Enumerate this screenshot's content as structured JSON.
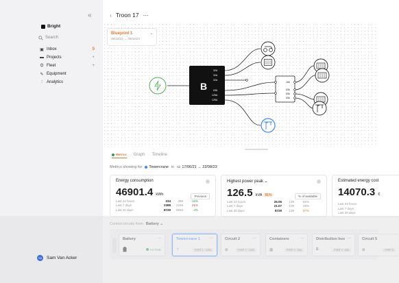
{
  "sidebar": {
    "collapse": "«",
    "brand": "Bright",
    "search_placeholder": "Search",
    "items": [
      {
        "label": "Inbox",
        "icon": "inbox-icon",
        "glyph": "▣",
        "badge": "5"
      },
      {
        "label": "Projects",
        "icon": "folder-icon",
        "glyph": "▬",
        "action": "+"
      },
      {
        "label": "Fleet",
        "icon": "fleet-icon",
        "glyph": "⛭",
        "action": "+"
      },
      {
        "label": "Equipment",
        "icon": "wrench-icon",
        "glyph": "✎"
      },
      {
        "label": "Analytics",
        "icon": "chart-icon",
        "glyph": "⫶"
      }
    ],
    "user": {
      "name": "Sam Van Acker",
      "initials": "SA"
    }
  },
  "header": {
    "back": "‹",
    "title": "Troon 17",
    "more": "···"
  },
  "blueprint": {
    "title": "Blueprint 1",
    "date": "08/12/23 → 09/12/23",
    "chevron": "⌄"
  },
  "diagram": {
    "main_ports": [
      "32A",
      "32A",
      "32A",
      "63A",
      "125A",
      "125A"
    ],
    "right_ports": [
      "16A",
      "63A",
      "63A",
      "63A"
    ]
  },
  "tabs": [
    "Metrics",
    "Graph",
    "Timeline"
  ],
  "metrics_for": {
    "label": "Metrics showing for",
    "asset": "Towercrane",
    "in": "in",
    "range": "17/06/21 → 22/08/23"
  },
  "cards": [
    {
      "title": "Energy consumption",
      "value": "46901.4",
      "unit": "kWh",
      "pill": "Previous",
      "rows": [
        {
          "label": "Last 24 hours",
          "v1": "234",
          "v2": "289",
          "v3": "-16%",
          "cls": "green"
        },
        {
          "label": "Last 7 days",
          "v1": "2398",
          "v2": "1249",
          "v3": "21%",
          "cls": "red"
        },
        {
          "label": "Last 30 days",
          "v1": "8729",
          "v2": "9833",
          "v3": "-4%",
          "cls": "green"
        }
      ]
    },
    {
      "title": "Highest power peak",
      "value": "126.5",
      "unit": "kVA",
      "pct": "91%",
      "pill": "% of available",
      "rows": [
        {
          "label": "Last 24 hours",
          "v1": "26.06",
          "v2": "139",
          "v3": "82%",
          "cls": ""
        },
        {
          "label": "Last 7 days",
          "v1": "21.07",
          "v2": "139",
          "v3": "49%",
          "cls": ""
        },
        {
          "label": "Last 30 days",
          "v1": "8729",
          "v2": "139",
          "v3": "87%",
          "cls": "orange"
        }
      ]
    },
    {
      "title": "Estimated energy cost",
      "value": "14070.3",
      "unit": "€",
      "rows": [
        {
          "label": "Last 24 hours"
        },
        {
          "label": "Last 7 days"
        },
        {
          "label": "Last 30 days"
        }
      ]
    }
  ],
  "control": {
    "label": "Control circuits from",
    "source": "Battery"
  },
  "circuits": [
    {
      "name": "Battery",
      "status": "ACTIVE",
      "icon": "battery-icon"
    },
    {
      "name": "Towercrane 1",
      "port": "PORT 1 · 125A",
      "icon": "crane-icon",
      "selected": true
    },
    {
      "name": "Circuit 2",
      "port": "PORT 2 · 125A",
      "icon": "disabled-icon"
    },
    {
      "name": "Containers",
      "port": "PORT 3 · 63A",
      "icon": "container-icon"
    },
    {
      "name": "Distribution box",
      "port": "PORT 4 · 63A",
      "icon": "distribution-icon"
    },
    {
      "name": "Circuit 5",
      "port": "PORT 5",
      "icon": "disabled-icon"
    }
  ],
  "colors": {
    "accent": "#e07a2c",
    "blue": "#3a86ff",
    "green": "#2f9e57"
  }
}
